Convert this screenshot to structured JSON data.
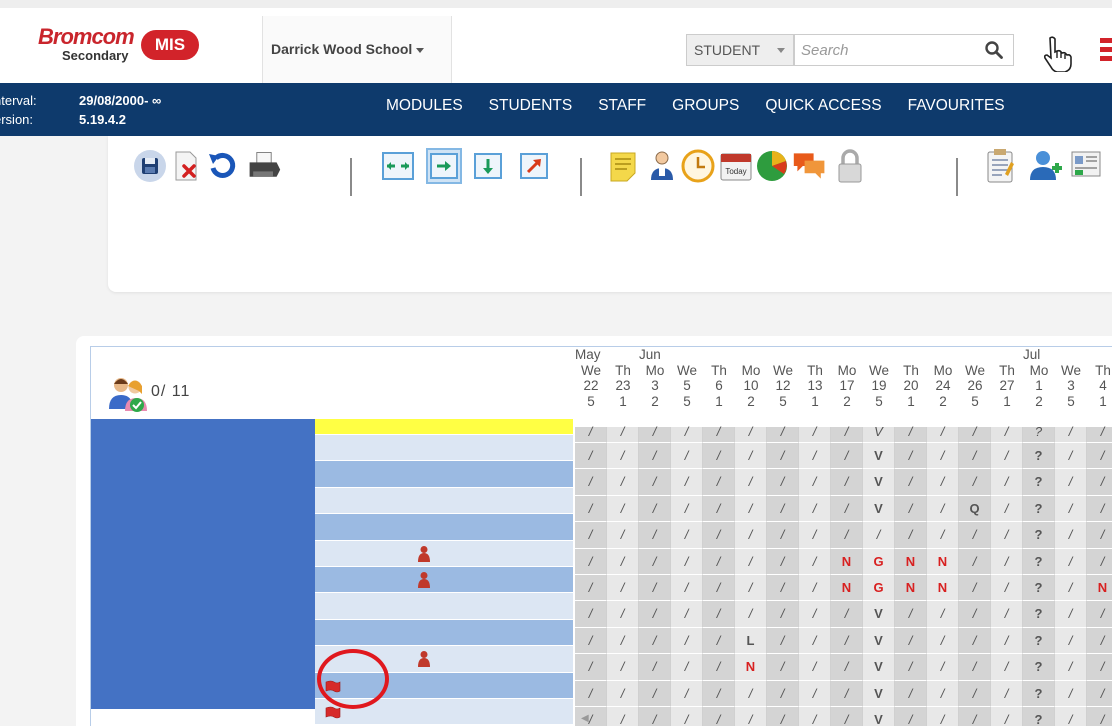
{
  "header": {
    "logo_brand": "Bromcom",
    "logo_sub": "Secondary",
    "logo_mis": "MIS",
    "school": "Darrick Wood School",
    "search_type": "STUDENT",
    "search_placeholder": "Search"
  },
  "nav": {
    "interval_label": "nterval:",
    "interval_value": "29/08/2000- ∞",
    "version_label": "ersion:",
    "version_value": "5.19.4.2",
    "items": [
      "MODULES",
      "STUDENTS",
      "STAFF",
      "GROUPS",
      "QUICK ACCESS",
      "FAVOURITES"
    ]
  },
  "toolbar": {
    "icons": [
      "save-icon",
      "delete-icon",
      "undo-icon",
      "print-icon",
      "expand-horizontal-icon",
      "arrow-right-icon",
      "arrow-down-icon",
      "arrow-diagonal-icon",
      "notes-icon",
      "user-icon",
      "clock-icon",
      "today-calendar-icon",
      "pie-chart-icon",
      "chat-icon",
      "lock-icon",
      "clipboard-icon",
      "add-user-icon",
      "id-card-icon"
    ],
    "today_label": "Today"
  },
  "grid": {
    "count": "0/ 11",
    "months": [
      {
        "label": "May",
        "col": 0
      },
      {
        "label": "Jun",
        "col": 2
      },
      {
        "label": "Jul",
        "col": 14
      }
    ],
    "columns": [
      {
        "day": "We",
        "date": "22",
        "period": "5"
      },
      {
        "day": "Th",
        "date": "23",
        "period": "1"
      },
      {
        "day": "Mo",
        "date": "3",
        "period": "2"
      },
      {
        "day": "We",
        "date": "5",
        "period": "5"
      },
      {
        "day": "Th",
        "date": "6",
        "period": "1"
      },
      {
        "day": "Mo",
        "date": "10",
        "period": "2"
      },
      {
        "day": "We",
        "date": "12",
        "period": "5"
      },
      {
        "day": "Th",
        "date": "13",
        "period": "1"
      },
      {
        "day": "Mo",
        "date": "17",
        "period": "2"
      },
      {
        "day": "We",
        "date": "19",
        "period": "5"
      },
      {
        "day": "Th",
        "date": "20",
        "period": "1"
      },
      {
        "day": "Mo",
        "date": "24",
        "period": "2"
      },
      {
        "day": "We",
        "date": "26",
        "period": "5"
      },
      {
        "day": "Th",
        "date": "27",
        "period": "1"
      },
      {
        "day": "Mo",
        "date": "1",
        "period": "2"
      },
      {
        "day": "We",
        "date": "3",
        "period": "5"
      },
      {
        "day": "Th",
        "date": "4",
        "period": "1"
      }
    ],
    "rows": [
      {
        "marker": "",
        "cells": [
          "/",
          "/",
          "/",
          "/",
          "/",
          "/",
          "/",
          "/",
          "/",
          "V",
          "/",
          "/",
          "/",
          "/",
          "?",
          "/",
          "/"
        ]
      },
      {
        "marker": "",
        "cells": [
          "/",
          "/",
          "/",
          "/",
          "/",
          "/",
          "/",
          "/",
          "/",
          "V",
          "/",
          "/",
          "/",
          "/",
          "?",
          "/",
          "/"
        ]
      },
      {
        "marker": "",
        "cells": [
          "/",
          "/",
          "/",
          "/",
          "/",
          "/",
          "/",
          "/",
          "/",
          "V",
          "/",
          "/",
          "Q",
          "/",
          "?",
          "/",
          "/"
        ]
      },
      {
        "marker": "",
        "cells": [
          "/",
          "/",
          "/",
          "/",
          "/",
          "/",
          "/",
          "/",
          "/",
          "/",
          "/",
          "/",
          "/",
          "/",
          "?",
          "/",
          "/"
        ]
      },
      {
        "marker": "person",
        "cells": [
          "/",
          "/",
          "/",
          "/",
          "/",
          "/",
          "/",
          "/",
          "N",
          "G",
          "N",
          "N",
          "/",
          "/",
          "?",
          "/",
          "/"
        ]
      },
      {
        "marker": "person",
        "cells": [
          "/",
          "/",
          "/",
          "/",
          "/",
          "/",
          "/",
          "/",
          "N",
          "G",
          "N",
          "N",
          "/",
          "/",
          "?",
          "/",
          "N"
        ]
      },
      {
        "marker": "",
        "cells": [
          "/",
          "/",
          "/",
          "/",
          "/",
          "/",
          "/",
          "/",
          "/",
          "V",
          "/",
          "/",
          "/",
          "/",
          "?",
          "/",
          "/"
        ]
      },
      {
        "marker": "",
        "cells": [
          "/",
          "/",
          "/",
          "/",
          "/",
          "L",
          "/",
          "/",
          "/",
          "V",
          "/",
          "/",
          "/",
          "/",
          "?",
          "/",
          "/"
        ]
      },
      {
        "marker": "person",
        "cells": [
          "/",
          "/",
          "/",
          "/",
          "/",
          "N",
          "/",
          "/",
          "/",
          "V",
          "/",
          "/",
          "/",
          "/",
          "?",
          "/",
          "/"
        ]
      },
      {
        "marker": "flag",
        "cells": [
          "/",
          "/",
          "/",
          "/",
          "/",
          "/",
          "/",
          "/",
          "/",
          "V",
          "/",
          "/",
          "/",
          "/",
          "?",
          "/",
          "/"
        ]
      },
      {
        "marker": "flag",
        "cells": [
          "/",
          "/",
          "/",
          "/",
          "/",
          "/",
          "/",
          "/",
          "/",
          "V",
          "/",
          "/",
          "/",
          "/",
          "?",
          "/",
          "/"
        ]
      }
    ],
    "highlight_color": "#ffff44",
    "row_colors": [
      "#dce6f3",
      "#9bbae2"
    ]
  }
}
